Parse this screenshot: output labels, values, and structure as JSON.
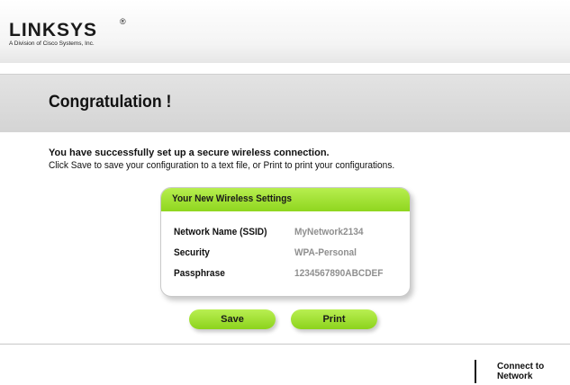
{
  "brand": {
    "logo_text": "LINKSYS",
    "registered_mark": "®",
    "tagline": "A Division of Cisco Systems, Inc."
  },
  "page": {
    "title": "Congratulation !",
    "message_bold": "You have successfully set up a secure wireless connection.",
    "message": "Click Save to save your configuration to a text file, or Print to print your configurations."
  },
  "settings": {
    "header": "Your New Wireless Settings",
    "rows": [
      {
        "label": "Network Name (SSID)",
        "value": "MyNetwork2134"
      },
      {
        "label": "Security",
        "value": "WPA-Personal"
      },
      {
        "label": "Passphrase",
        "value": "1234567890ABCDEF"
      }
    ]
  },
  "buttons": {
    "save": "Save",
    "print": "Print"
  },
  "footer": {
    "connect_line1": "Connect to",
    "connect_line2": "Network"
  },
  "colors": {
    "accent_green": "#9ddf2e",
    "value_gray": "#8f8f8f",
    "band_gray": "#d9d9d9"
  }
}
